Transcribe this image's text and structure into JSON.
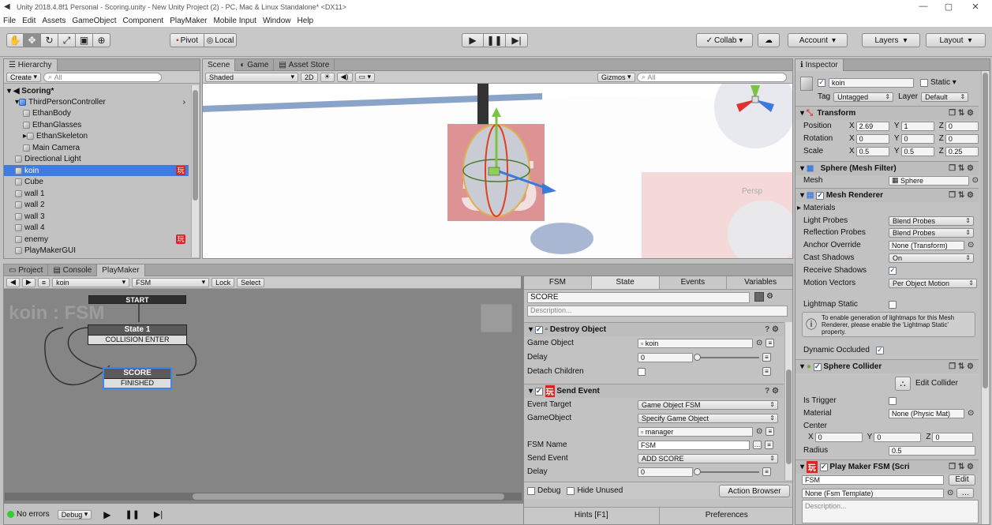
{
  "window": {
    "title": "Unity 2018.4.8f1 Personal - Scoring.unity - New Unity Project (2) - PC, Mac & Linux Standalone* <DX11>"
  },
  "menu": [
    "File",
    "Edit",
    "Assets",
    "GameObject",
    "Component",
    "PlayMaker",
    "Mobile Input",
    "Window",
    "Help"
  ],
  "toolbar": {
    "pivot": "Pivot",
    "local": "Local",
    "collab": "Collab",
    "account": "Account",
    "layers": "Layers",
    "layout": "Layout"
  },
  "hierarchy": {
    "tab": "Hierarchy",
    "create": "Create",
    "search_placeholder": "All",
    "scene": "Scoring*",
    "items": [
      {
        "label": "ThirdPersonController",
        "indent": 1
      },
      {
        "label": "EthanBody",
        "indent": 2
      },
      {
        "label": "EthanGlasses",
        "indent": 2
      },
      {
        "label": "EthanSkeleton",
        "indent": 2
      },
      {
        "label": "Main Camera",
        "indent": 2
      },
      {
        "label": "Directional Light",
        "indent": 1
      },
      {
        "label": "koin",
        "indent": 1
      },
      {
        "label": "Cube",
        "indent": 1
      },
      {
        "label": "wall 1",
        "indent": 1
      },
      {
        "label": "wall 2",
        "indent": 1
      },
      {
        "label": "wall 3",
        "indent": 1
      },
      {
        "label": "wall 4",
        "indent": 1
      },
      {
        "label": "enemy",
        "indent": 1
      },
      {
        "label": "PlayMakerGUI",
        "indent": 1
      }
    ]
  },
  "scene": {
    "tabs": [
      "Scene",
      "Game",
      "Asset Store"
    ],
    "shading": "Shaded",
    "mode_2d": "2D",
    "gizmos": "Gizmos",
    "search_placeholder": "All",
    "persp": "Persp"
  },
  "bottom": {
    "tabs": [
      "Project",
      "Console",
      "PlayMaker"
    ],
    "object": "koin",
    "fsm": "FSM",
    "lock": "Lock",
    "select": "Select",
    "fsm_title": "koin : FSM",
    "status": "No errors",
    "debug": "Debug",
    "hints": "Hints [F1]",
    "preferences": "Preferences"
  },
  "fsm_graph": {
    "start": "START",
    "state1": "State 1",
    "state1_event": "COLLISION ENTER",
    "score": "SCORE",
    "score_event": "FINISHED"
  },
  "state_panel": {
    "tabs": [
      "FSM",
      "State",
      "Events",
      "Variables"
    ],
    "state_name": "SCORE",
    "description_placeholder": "Description...",
    "destroy": {
      "title": "Destroy Object",
      "game_object_label": "Game Object",
      "game_object": "koin",
      "delay_label": "Delay",
      "delay": "0",
      "detach_label": "Detach Children"
    },
    "send": {
      "title": "Send Event",
      "target_label": "Event Target",
      "target": "Game Object FSM",
      "go_label": "GameObject",
      "go": "Specify Game Object",
      "go_value": "manager",
      "fsm_name_label": "FSM Name",
      "fsm_name": "FSM",
      "send_label": "Send Event",
      "send": "ADD SCORE",
      "delay_label": "Delay",
      "delay": "0"
    },
    "footer": {
      "debug": "Debug",
      "hide_unused": "Hide Unused",
      "action_browser": "Action Browser"
    }
  },
  "inspector": {
    "tab": "Inspector",
    "name": "koin",
    "static": "Static",
    "tag_label": "Tag",
    "tag": "Untagged",
    "layer_label": "Layer",
    "layer": "Default",
    "transform": {
      "title": "Transform",
      "position_label": "Position",
      "rotation_label": "Rotation",
      "scale_label": "Scale",
      "position": [
        "2.69",
        "1",
        "0"
      ],
      "rotation": [
        "0",
        "0",
        "0"
      ],
      "scale": [
        "0.5",
        "0.5",
        "0.25"
      ]
    },
    "mesh_filter": {
      "title": "Sphere (Mesh Filter)",
      "mesh_label": "Mesh",
      "mesh": "Sphere"
    },
    "mesh_renderer": {
      "title": "Mesh Renderer",
      "materials": "Materials",
      "light_probes_label": "Light Probes",
      "light_probes": "Blend Probes",
      "reflection_label": "Reflection Probes",
      "reflection": "Blend Probes",
      "anchor_label": "Anchor Override",
      "anchor": "None (Transform)",
      "cast_label": "Cast Shadows",
      "cast": "On",
      "receive_label": "Receive Shadows",
      "motion_label": "Motion Vectors",
      "motion": "Per Object Motion",
      "lightmap_label": "Lightmap Static",
      "info": "To enable generation of lightmaps for this Mesh Renderer, please enable the 'Lightmap Static' property.",
      "occluded_label": "Dynamic Occluded"
    },
    "collider": {
      "title": "Sphere Collider",
      "edit": "Edit Collider",
      "trigger_label": "Is Trigger",
      "material_label": "Material",
      "material": "None (Physic Mat)",
      "center_label": "Center",
      "center": [
        "0",
        "0",
        "0"
      ],
      "radius_label": "Radius",
      "radius": "0.5"
    },
    "playmaker": {
      "title": "Play Maker FSM (Scri",
      "fsm": "FSM",
      "edit": "Edit",
      "template": "None (Fsm Template)",
      "description_placeholder": "Description..."
    }
  },
  "axes": {
    "x": "X",
    "y": "Y",
    "z": "Z"
  }
}
